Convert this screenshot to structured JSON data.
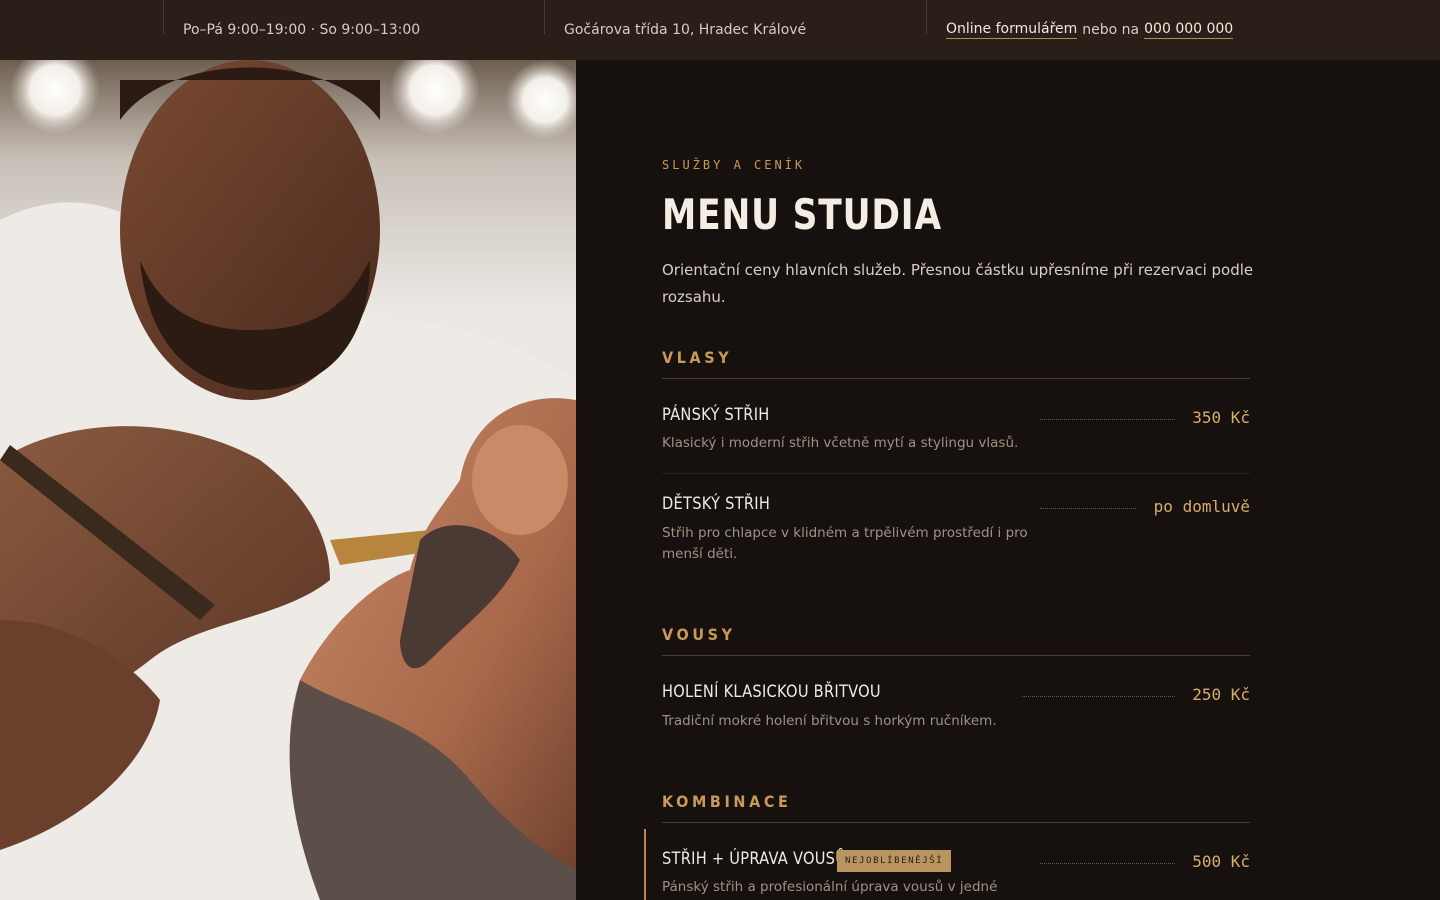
{
  "topbar": {
    "hours": "Po–Pá 9:00–19:00 · So 9:00–13:00",
    "address": "Gočárova třída 10, Hradec Králové",
    "booking_link": "Online formulářem",
    "booking_mid": "nebo na",
    "phone": "000 000 000"
  },
  "photo": {
    "icon": "barber-shaving-photo"
  },
  "menu": {
    "eyebrow": "SLUŽBY A CENÍK",
    "title": "MENU STUDIA",
    "intro": "Orientační ceny hlavních služeb. Přesnou částku upřesníme při rezervaci podle rozsahu.",
    "sections": [
      {
        "title": "VLASY",
        "items": [
          {
            "name": "PÁNSKÝ STŘIH",
            "desc": "Klasický i moderní střih včetně mytí a stylingu vlasů.",
            "price": "350 Kč"
          },
          {
            "name": "DĚTSKÝ STŘIH",
            "desc": "Střih pro chlapce v klidném a trpělivém prostředí i pro menší děti.",
            "price": "po domluvě"
          }
        ]
      },
      {
        "title": "VOUSY",
        "items": [
          {
            "name": "HOLENÍ KLASICKOU BŘITVOU",
            "desc": "Tradiční mokré holení břitvou s horkým ručníkem.",
            "price": "250 Kč"
          }
        ]
      },
      {
        "title": "KOMBINACE",
        "items": [
          {
            "name": "STŘIH + ÚPRAVA VOUSŮ",
            "badge": "NEJOBLÍBENĚJŠÍ",
            "desc": "Pánský střih a profesionální úprava vousů v jedné",
            "price": "500 Kč"
          }
        ]
      }
    ]
  },
  "colors": {
    "accent": "#c79a5a",
    "background": "#16110e",
    "topbar": "#2a1e18"
  }
}
